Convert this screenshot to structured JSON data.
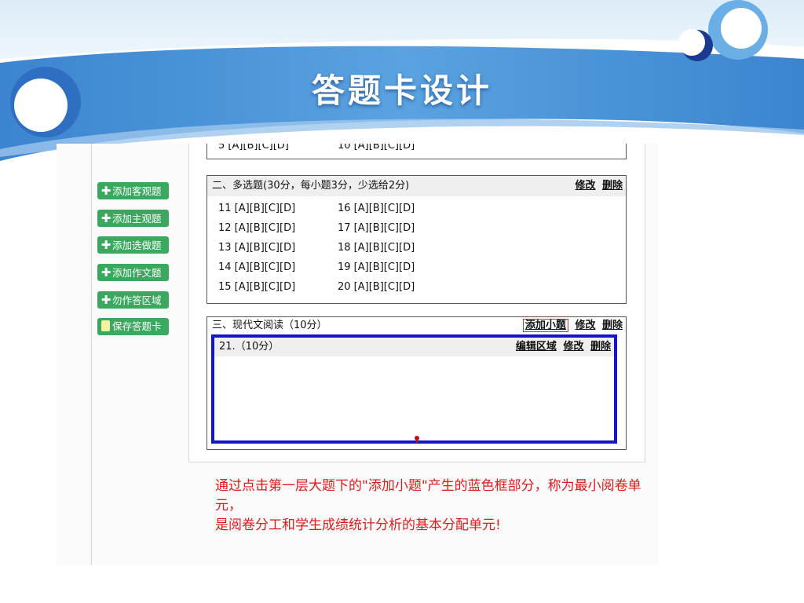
{
  "slide": {
    "title": "答题卡设计"
  },
  "sidebar": {
    "buttons": [
      {
        "label": "添加客观题"
      },
      {
        "label": "添加主观题"
      },
      {
        "label": "添加选做题"
      },
      {
        "label": "添加作文题"
      },
      {
        "label": "勿作答区域"
      },
      {
        "label": "保存答题卡"
      }
    ]
  },
  "section1": {
    "items": [
      "5 [A][B][C][D]",
      "10 [A][B][C][D]"
    ]
  },
  "section2": {
    "title": "二、多选题(30分，每小题3分，少选给2分)",
    "edit": "修改",
    "delete": "删除",
    "col1": [
      "11 [A][B][C][D]",
      "12 [A][B][C][D]",
      "13 [A][B][C][D]",
      "14 [A][B][C][D]",
      "15 [A][B][C][D]"
    ],
    "col2": [
      "16 [A][B][C][D]",
      "17 [A][B][C][D]",
      "18 [A][B][C][D]",
      "19 [A][B][C][D]",
      "20 [A][B][C][D]"
    ]
  },
  "section3": {
    "title": "三、现代文阅读（10分）",
    "add_sub": "添加小题",
    "edit": "修改",
    "delete": "删除",
    "sub": {
      "title": "21.（10分）",
      "edit_region": "编辑区域",
      "edit": "修改",
      "delete": "删除"
    }
  },
  "caption": {
    "line1": "通过点击第一层大题下的\"添加小题\"产生的蓝色框部分，称为最小阅卷单元，",
    "line2": "是阅卷分工和学生成绩统计分析的基本分配单元!"
  },
  "colors": {
    "accent_blue": "#1414c8",
    "button_green": "#3aa85f",
    "caption_red": "#e01a1a",
    "header_blue": "#4f96d6"
  }
}
